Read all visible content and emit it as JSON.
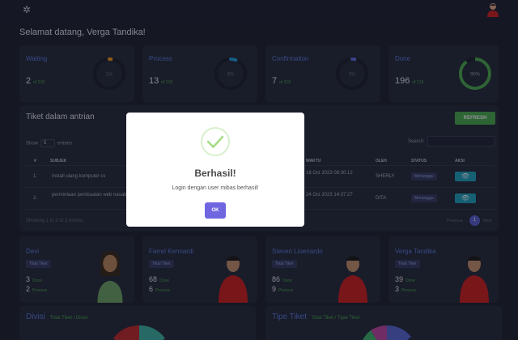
{
  "header": {
    "welcome": "Selamat datang, Verga Tandika!"
  },
  "stats": [
    {
      "title": "Waiting",
      "value": "2",
      "of": "of 218",
      "percent_label": "1%",
      "percent": 0.01,
      "color": "#f0a020"
    },
    {
      "title": "Process",
      "value": "13",
      "of": "of 218",
      "percent_label": "6%",
      "percent": 0.06,
      "color": "#20a0e0"
    },
    {
      "title": "Confirmation",
      "value": "7",
      "of": "of 218",
      "percent_label": "3%",
      "percent": 0.03,
      "color": "#5b6fe0"
    },
    {
      "title": "Done",
      "value": "196",
      "of": "of 218",
      "percent_label": "90%",
      "percent": 0.9,
      "color": "#4caf50"
    }
  ],
  "queue": {
    "title": "Tiket dalam antrian",
    "refresh_label": "REFRESH",
    "show_label": "Show",
    "entries_value": "5",
    "entries_label": "entries",
    "search_label": "Search:",
    "columns": [
      "#",
      "SUBJEK",
      "WAKTU",
      "OLEH",
      "STATUS",
      "AKSI"
    ],
    "rows": [
      {
        "no": "1.",
        "subject": "Install ulang komputer cs",
        "time": "18 Oct 2023 08:30:12",
        "by": "SHERLY",
        "status": "Menunggu"
      },
      {
        "no": "2.",
        "subject": "permintaan pembuatan web nasabah",
        "time": "24 Oct 2023 14:37:27",
        "by": "DITA",
        "status": "Menunggu"
      }
    ],
    "showing": "Showing 1 to 2 of 2 entries",
    "prev": "Previous",
    "page": "1",
    "next": "Next"
  },
  "people": [
    {
      "name": "Devi",
      "badge": "Total Tiket",
      "done": "3",
      "process": "2",
      "done_label": "Done",
      "process_label": "Process"
    },
    {
      "name": "Farrel Kennardi",
      "badge": "Total Tiket",
      "done": "68",
      "process": "6",
      "done_label": "Done",
      "process_label": "Process"
    },
    {
      "name": "Steven Lioenardo",
      "badge": "Total Tiket",
      "done": "86",
      "process": "9",
      "done_label": "Done",
      "process_label": "Process"
    },
    {
      "name": "Verga Tandika",
      "badge": "Total Tiket",
      "done": "39",
      "process": "3",
      "done_label": "Done",
      "process_label": "Process"
    }
  ],
  "bottom": [
    {
      "title": "Divisi",
      "sub": "Total Tiket / Divisi"
    },
    {
      "title": "Tipe Tiket",
      "sub": "Total Tiket / Type Tiket"
    }
  ],
  "modal": {
    "title": "Berhasil!",
    "text": "Login dengan user mibas berhasil!",
    "ok_label": "OK",
    "check_color": "#a5dc86"
  }
}
